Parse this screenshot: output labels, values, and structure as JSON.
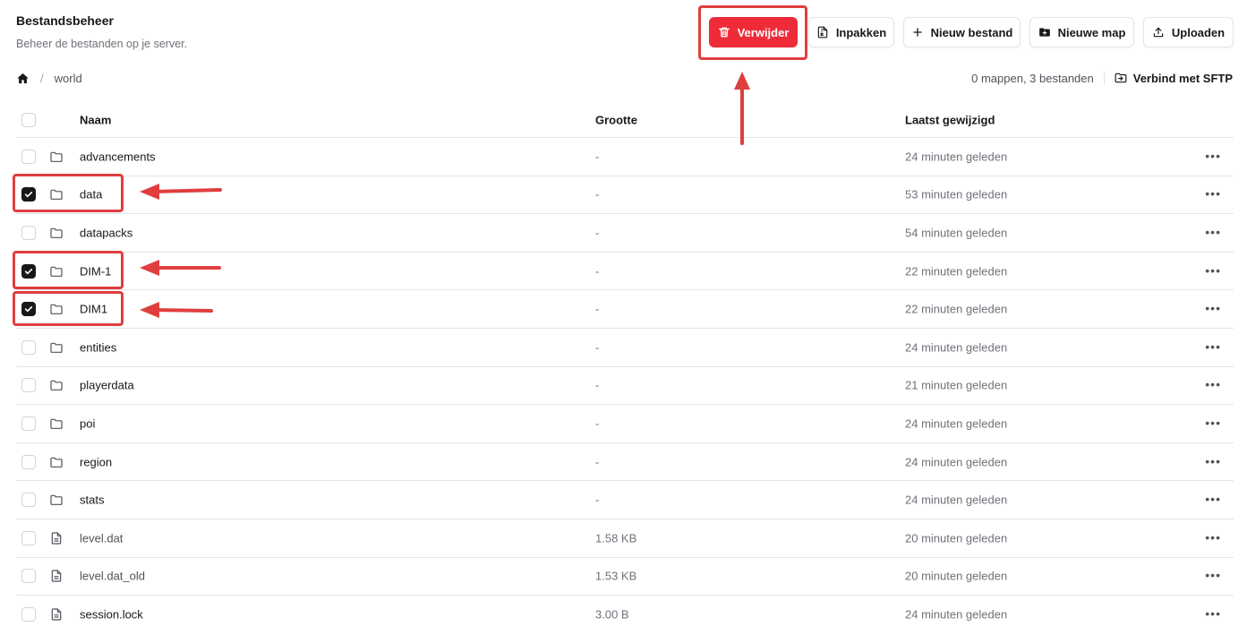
{
  "header": {
    "title": "Bestandsbeheer",
    "subtitle": "Beheer de bestanden op je server."
  },
  "toolbar": {
    "delete_label": "Verwijder",
    "pack_label": "Inpakken",
    "new_file_label": "Nieuw bestand",
    "new_folder_label": "Nieuwe map",
    "upload_label": "Uploaden"
  },
  "breadcrumb": {
    "separator": "/",
    "current": "world"
  },
  "summary": {
    "count": "0 mappen, 3 bestanden",
    "sftp_label": "Verbind met SFTP"
  },
  "table": {
    "columns": {
      "name": "Naam",
      "size": "Grootte",
      "modified": "Laatst gewijzigd"
    },
    "rows": [
      {
        "name": "advancements",
        "size": "-",
        "modified": "24 minuten geleden",
        "type": "folder",
        "checked": false
      },
      {
        "name": "data",
        "size": "-",
        "modified": "53 minuten geleden",
        "type": "folder",
        "checked": true
      },
      {
        "name": "datapacks",
        "size": "-",
        "modified": "54 minuten geleden",
        "type": "folder",
        "checked": false
      },
      {
        "name": "DIM-1",
        "size": "-",
        "modified": "22 minuten geleden",
        "type": "folder",
        "checked": true
      },
      {
        "name": "DIM1",
        "size": "-",
        "modified": "22 minuten geleden",
        "type": "folder",
        "checked": true
      },
      {
        "name": "entities",
        "size": "-",
        "modified": "24 minuten geleden",
        "type": "folder",
        "checked": false
      },
      {
        "name": "playerdata",
        "size": "-",
        "modified": "21 minuten geleden",
        "type": "folder",
        "checked": false
      },
      {
        "name": "poi",
        "size": "-",
        "modified": "24 minuten geleden",
        "type": "folder",
        "checked": false
      },
      {
        "name": "region",
        "size": "-",
        "modified": "24 minuten geleden",
        "type": "folder",
        "checked": false
      },
      {
        "name": "stats",
        "size": "-",
        "modified": "24 minuten geleden",
        "type": "folder",
        "checked": false
      },
      {
        "name": "level.dat",
        "size": "1.58 KB",
        "modified": "20 minuten geleden",
        "type": "file",
        "checked": false
      },
      {
        "name": "level.dat_old",
        "size": "1.53 KB",
        "modified": "20 minuten geleden",
        "type": "file",
        "checked": false
      },
      {
        "name": "session.lock",
        "size": "3.00 B",
        "modified": "24 minuten geleden",
        "type": "file",
        "checked": false
      }
    ],
    "row_menu_glyph": "•••"
  },
  "colors": {
    "danger": "#ef2b39",
    "annotation": "#e03e3e",
    "checked": "#18181b"
  }
}
